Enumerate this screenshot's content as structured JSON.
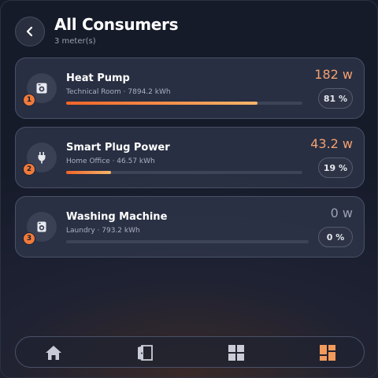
{
  "header": {
    "title": "All Consumers",
    "subtitle": "3 meter(s)"
  },
  "consumers": [
    {
      "rank": "1",
      "name": "Heat Pump",
      "meta": "Technical Room · 7894.2 kWh",
      "power": "182 w",
      "percent": "81 %",
      "share": 0.81,
      "icon": "washer-icon"
    },
    {
      "rank": "2",
      "name": "Smart Plug Power",
      "meta": "Home Office · 46.57 kWh",
      "power": "43.2 w",
      "percent": "19 %",
      "share": 0.19,
      "icon": "plug-icon"
    },
    {
      "rank": "3",
      "name": "Washing Machine",
      "meta": "Laundry · 793.2 kWh",
      "power": "0 w",
      "percent": "0 %",
      "share": 0.0,
      "icon": "washer-icon"
    }
  ],
  "nav": [
    "home-icon",
    "door-icon",
    "grid-icon",
    "dashboard-icon"
  ],
  "colors": {
    "accent": "#f07a3a",
    "power": "#f4a070",
    "muted": "#9aa0b0"
  }
}
